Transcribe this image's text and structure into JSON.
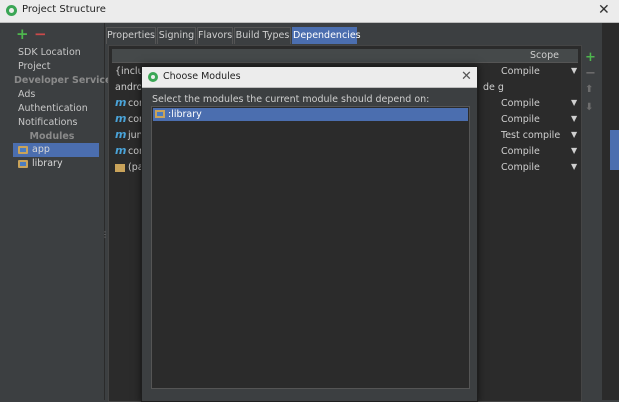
{
  "window": {
    "title": "Project Structure"
  },
  "toolbar": {
    "add": "+",
    "remove": "−"
  },
  "sidebar": {
    "items": [
      "SDK Location",
      "Project"
    ],
    "developer_services_header": "Developer Services",
    "services": [
      "Ads",
      "Authentication",
      "Notifications"
    ],
    "modules_header": "Modules",
    "modules": [
      {
        "label": "app",
        "selected": true
      },
      {
        "label": "library",
        "selected": false
      }
    ]
  },
  "tabs": [
    {
      "label": "Properties",
      "active": false
    },
    {
      "label": "Signing",
      "active": false
    },
    {
      "label": "Flavors",
      "active": false
    },
    {
      "label": "Build Types",
      "active": false
    },
    {
      "label": "Dependencies",
      "active": true
    }
  ],
  "dependencies": {
    "scope_header": "Scope",
    "rows": [
      {
        "icon": "",
        "name": "{includ",
        "scope": "Compile"
      },
      {
        "icon": "",
        "name": "androi",
        "suffix": "de g",
        "scope": ""
      },
      {
        "icon": "m",
        "name": "com",
        "scope": "Compile"
      },
      {
        "icon": "m",
        "name": "com",
        "scope": "Compile"
      },
      {
        "icon": "m",
        "name": "juni",
        "scope": "Test compile"
      },
      {
        "icon": "m",
        "name": "com",
        "scope": "Compile"
      },
      {
        "icon": "folder",
        "name": "(pat",
        "scope": "Compile"
      }
    ]
  },
  "right_toolbar": {
    "add": "+",
    "remove": "−",
    "up": "⬆",
    "down": "⬇"
  },
  "dialog": {
    "title": "Choose Modules",
    "close": "✕",
    "prompt": "Select the modules the current module should depend on:",
    "items": [
      {
        "label": ":library",
        "selected": true
      }
    ]
  },
  "colors": {
    "selection": "#4b6eaf",
    "background": "#3c3f41",
    "panel": "#2b2b2b",
    "add": "#4eb64e",
    "remove": "#c94a4a",
    "module_icon": "#4aa3d8"
  }
}
